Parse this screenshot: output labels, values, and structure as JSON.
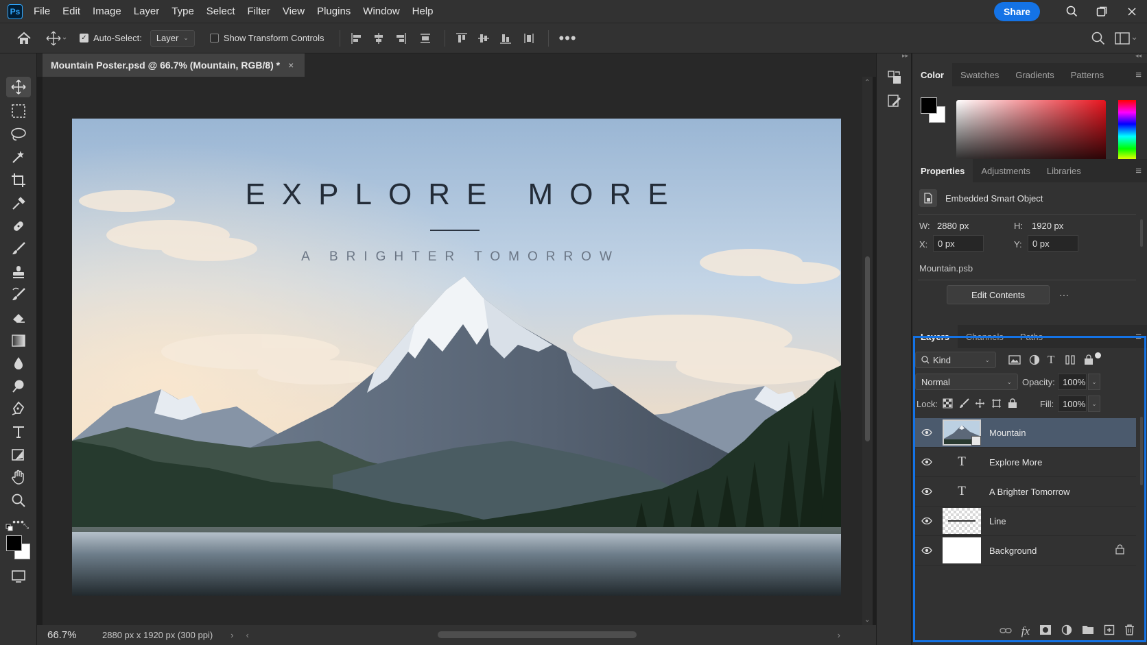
{
  "app": {
    "logo_text": "Ps"
  },
  "menu": [
    "File",
    "Edit",
    "Image",
    "Layer",
    "Type",
    "Select",
    "Filter",
    "View",
    "Plugins",
    "Window",
    "Help"
  ],
  "header": {
    "share_label": "Share"
  },
  "options": {
    "auto_select_label": "Auto-Select:",
    "auto_select_checked": true,
    "auto_select_target": "Layer",
    "transform_label": "Show Transform Controls",
    "transform_checked": false
  },
  "document": {
    "tab_title": "Mountain Poster.psd @ 66.7% (Mountain, RGB/8) *",
    "poster_title": "EXPLORE MORE",
    "poster_subtitle": "A BRIGHTER TOMORROW"
  },
  "status": {
    "zoom": "66.7%",
    "info": "2880 px x 1920 px (300 ppi)"
  },
  "color_panel": {
    "tabs": [
      "Color",
      "Swatches",
      "Gradients",
      "Patterns"
    ],
    "active_tab": "Color",
    "foreground": "#000000",
    "background": "#ffffff"
  },
  "properties_panel": {
    "tabs": [
      "Properties",
      "Adjustments",
      "Libraries"
    ],
    "active_tab": "Properties",
    "type_label": "Embedded Smart Object",
    "w_label": "W:",
    "w_value": "2880 px",
    "h_label": "H:",
    "h_value": "1920 px",
    "x_label": "X:",
    "x_value": "0 px",
    "y_label": "Y:",
    "y_value": "0 px",
    "source_file": "Mountain.psb",
    "edit_contents_label": "Edit Contents",
    "more_label": "···"
  },
  "layers_panel": {
    "tabs": [
      "Layers",
      "Channels",
      "Paths"
    ],
    "active_tab": "Layers",
    "filter_kind": "Kind",
    "blend_mode": "Normal",
    "opacity_label": "Opacity:",
    "opacity_value": "100%",
    "lock_label": "Lock:",
    "fill_label": "Fill:",
    "fill_value": "100%",
    "layers": [
      {
        "name": "Mountain",
        "type": "smart-object",
        "visible": true,
        "selected": true,
        "locked": false
      },
      {
        "name": "Explore More",
        "type": "text",
        "visible": true,
        "selected": false,
        "locked": false
      },
      {
        "name": "A Brighter Tomorrow",
        "type": "text",
        "visible": true,
        "selected": false,
        "locked": false
      },
      {
        "name": "Line",
        "type": "shape",
        "visible": true,
        "selected": false,
        "locked": false
      },
      {
        "name": "Background",
        "type": "fill",
        "visible": true,
        "selected": false,
        "locked": true
      }
    ]
  },
  "colors": {
    "accent": "#1473e6",
    "selected_layer": "#4b5a6d"
  }
}
